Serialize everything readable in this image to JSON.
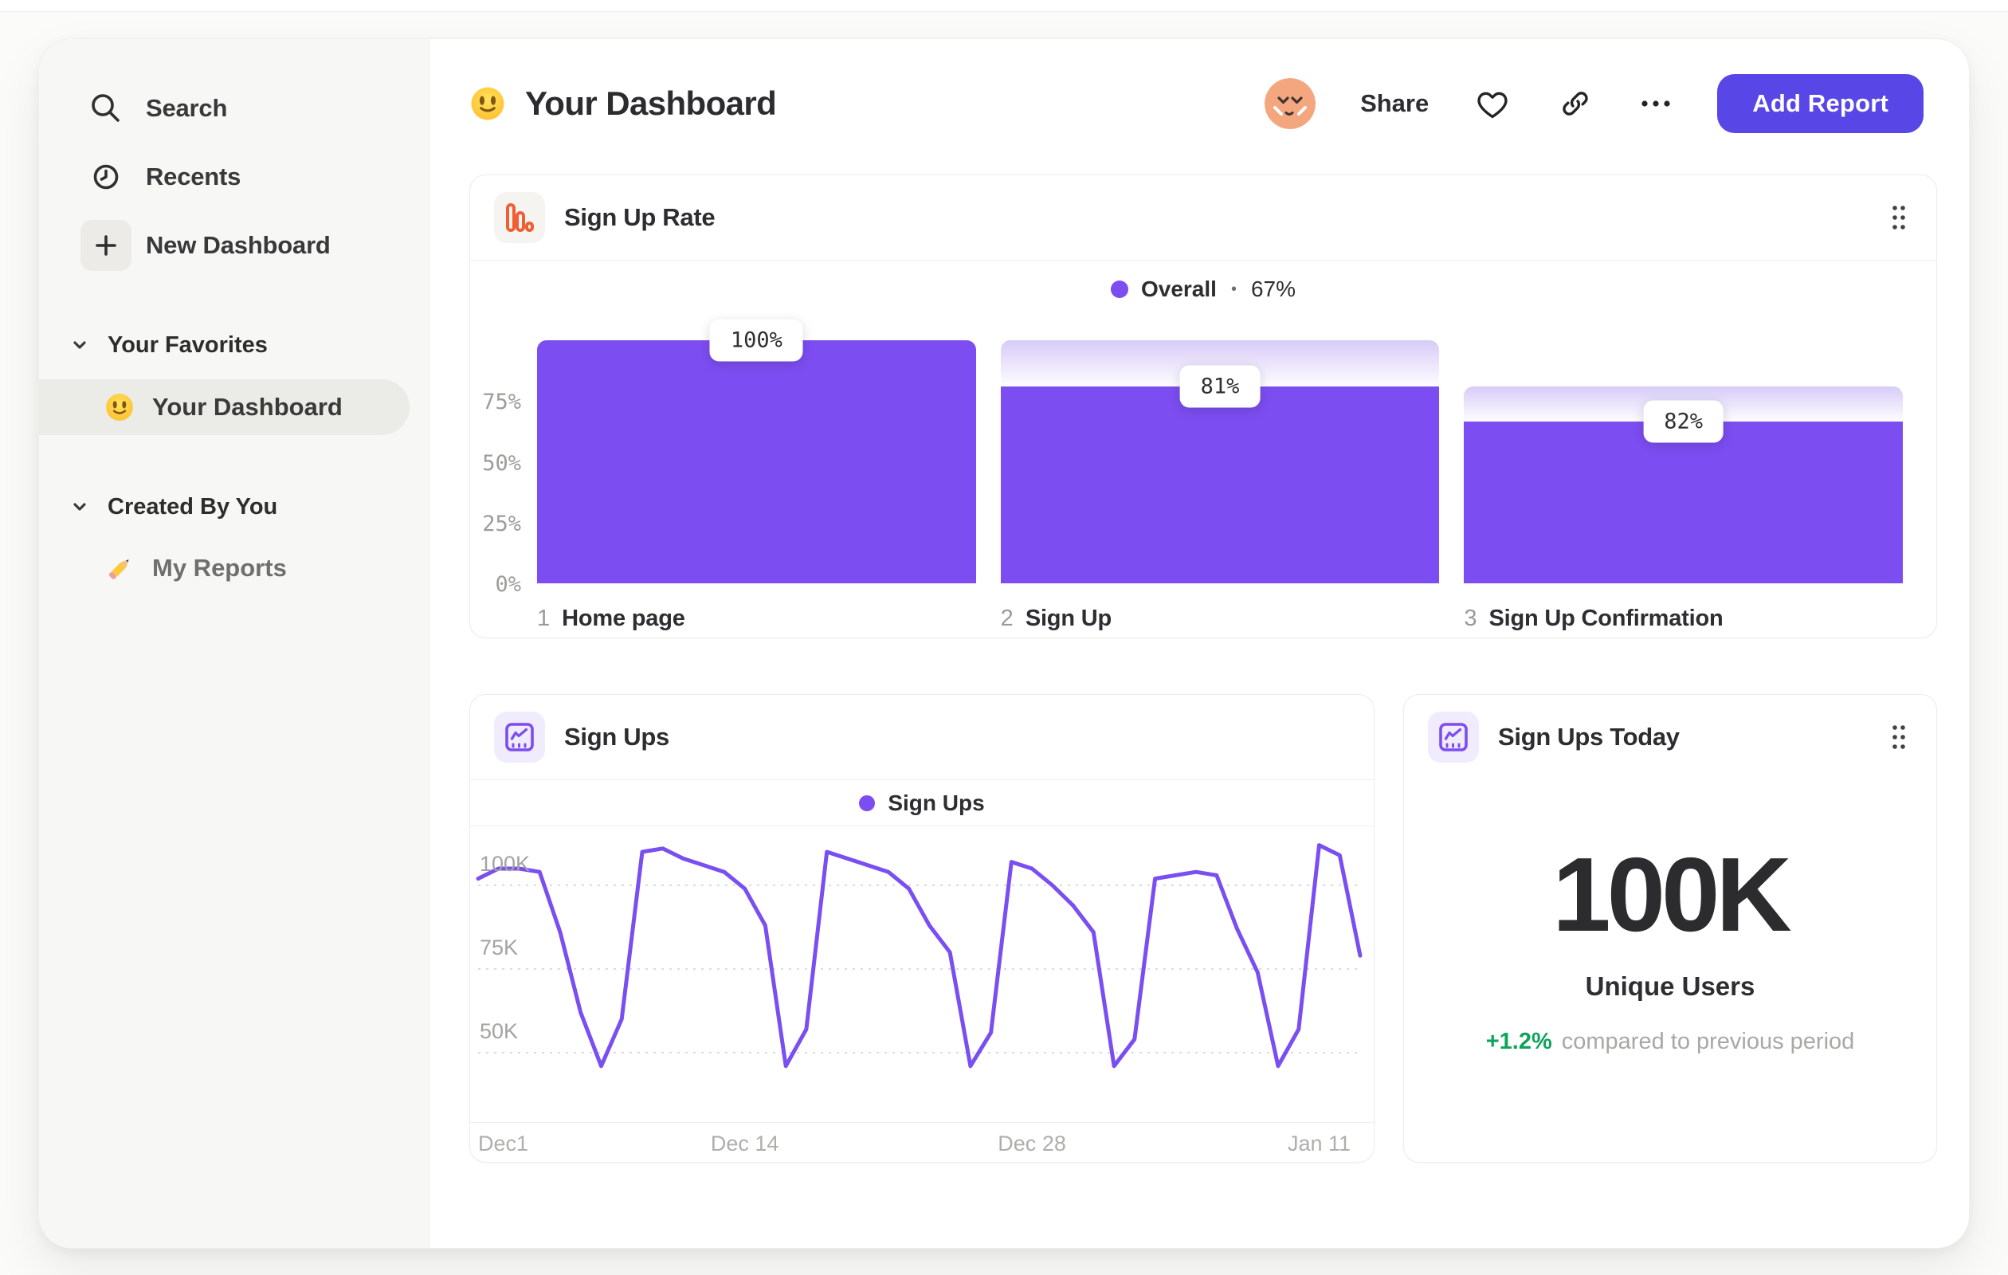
{
  "sidebar": {
    "nav": [
      {
        "label": "Search"
      },
      {
        "label": "Recents"
      },
      {
        "label": "New Dashboard"
      }
    ],
    "sections": [
      {
        "title": "Your Favorites",
        "items": [
          {
            "label": "Your Dashboard",
            "active": true
          }
        ]
      },
      {
        "title": "Created By You",
        "items": [
          {
            "label": "My Reports",
            "active": false
          }
        ]
      }
    ]
  },
  "header": {
    "title": "Your Dashboard",
    "share_label": "Share",
    "add_report_label": "Add Report"
  },
  "signup_rate_card": {
    "title": "Sign Up Rate",
    "legend": {
      "label": "Overall",
      "separator": "•",
      "value": "67%"
    }
  },
  "signups_card": {
    "title": "Sign Ups",
    "legend": {
      "label": "Sign Ups"
    }
  },
  "today_card": {
    "title": "Sign Ups Today",
    "value": "100K",
    "subtitle": "Unique Users",
    "delta": "+1.2%",
    "delta_note": "compared to previous period"
  },
  "chart_data": [
    {
      "type": "bar",
      "variant": "funnel",
      "title": "Sign Up Rate",
      "legend": [
        {
          "name": "Overall",
          "value_pct": 67
        }
      ],
      "ylim": [
        0,
        100
      ],
      "yticks": [
        {
          "label": "75%",
          "value": 75
        },
        {
          "label": "50%",
          "value": 50
        },
        {
          "label": "25%",
          "value": 25
        },
        {
          "label": "0%",
          "value": 0
        }
      ],
      "steps": [
        {
          "index": "1",
          "label": "Home page",
          "pct_label": "100%",
          "conversion_pct": 100,
          "cumulative_pct": 100
        },
        {
          "index": "2",
          "label": "Sign Up",
          "pct_label": "81%",
          "conversion_pct": 81,
          "cumulative_pct": 81
        },
        {
          "index": "3",
          "label": "Sign Up Confirmation",
          "pct_label": "82%",
          "conversion_pct": 82,
          "cumulative_pct": 66.5
        }
      ]
    },
    {
      "type": "line",
      "title": "Sign Ups",
      "grid": "dashed-horizontal",
      "legend_position": "top-center",
      "ylim": [
        38,
        116
      ],
      "yticks": [
        {
          "label": "100K",
          "value": 100
        },
        {
          "label": "75K",
          "value": 75
        },
        {
          "label": "50K",
          "value": 50
        }
      ],
      "xticks": [
        {
          "label": "Dec1",
          "day": 0
        },
        {
          "label": "Dec 14",
          "day": 13
        },
        {
          "label": "Dec 28",
          "day": 27
        },
        {
          "label": "Jan 11",
          "day": 41
        }
      ],
      "series": [
        {
          "name": "Sign Ups",
          "unit": "K",
          "values": [
            102,
            105,
            105,
            104,
            86,
            62,
            46,
            60,
            110,
            111,
            108,
            106,
            104,
            99,
            88,
            46,
            57,
            110,
            108,
            106,
            104,
            99,
            88,
            80,
            46,
            56,
            107,
            105,
            100,
            94,
            86,
            46,
            54,
            102,
            103,
            104,
            103,
            87,
            74,
            46,
            57,
            112,
            109,
            79
          ]
        }
      ]
    },
    {
      "type": "stat",
      "title": "Sign Ups Today",
      "value": "100K",
      "label": "Unique Users",
      "delta_pct": "+1.2%",
      "comparison": "compared to previous period"
    }
  ],
  "colors": {
    "accent_purple": "#7C4DF0",
    "accent_purple_light": "#D7CBF8",
    "line_purple": "#7A4FF2",
    "button_indigo": "#5847E6",
    "icon_orange": "#EF5F33",
    "positive_green": "#0FA35C",
    "avatar_peach": "#F4A67E",
    "emoji_yellow": "#FFD43B"
  }
}
